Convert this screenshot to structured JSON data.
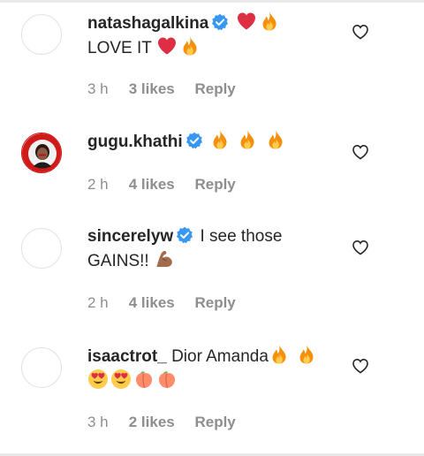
{
  "comments": [
    {
      "username": "natashagalkina",
      "verified": true,
      "text": "LOVE IT",
      "header_emojis": [
        "red-heart",
        "fire"
      ],
      "text_emojis": [
        "red-heart",
        "fire"
      ],
      "time": "3 h",
      "likes": "3 likes",
      "reply": "Reply",
      "avatar": "blank"
    },
    {
      "username": "gugu.khathi",
      "verified": true,
      "text": "",
      "header_emojis": [
        "fire",
        "fire",
        "fire"
      ],
      "time": "2 h",
      "likes": "4 likes",
      "reply": "Reply",
      "avatar": "photo"
    },
    {
      "username": "sincerelyw",
      "verified": true,
      "text": "I see those GAINS!!",
      "text_emojis": [
        "flexed-biceps"
      ],
      "time": "2 h",
      "likes": "4 likes",
      "reply": "Reply",
      "avatar": "blank"
    },
    {
      "username": "isaactrot_",
      "verified": false,
      "text": "Dior Amanda",
      "text_emojis": [
        "fire",
        "fire",
        "heart-eyes",
        "heart-eyes",
        "peach",
        "peach"
      ],
      "time": "3 h",
      "likes": "2 likes",
      "reply": "Reply",
      "avatar": "blank"
    }
  ],
  "colors": {
    "text": "#262626",
    "meta": "#8e8e8e",
    "verified": "#3897f0",
    "divider": "#e9e9e9"
  }
}
